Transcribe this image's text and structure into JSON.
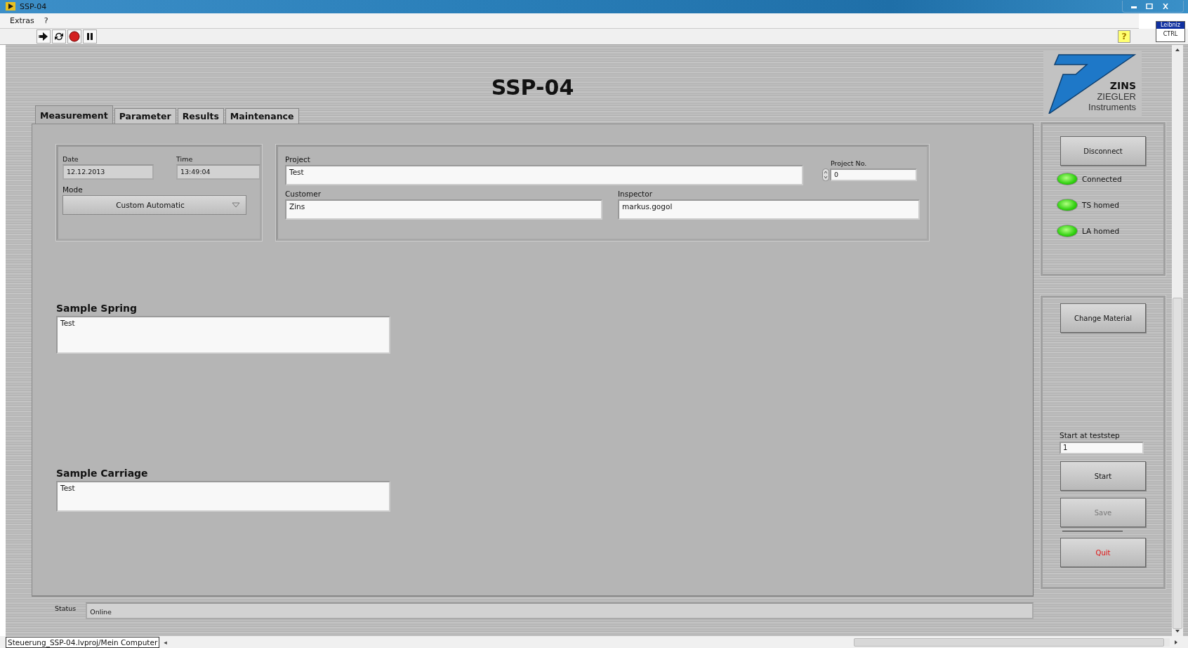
{
  "window": {
    "title": "SSP-04"
  },
  "menu": [
    "Extras",
    "?"
  ],
  "help_button": "?",
  "badge": {
    "top": "Leibniz",
    "label": "CTRL"
  },
  "heading": "SSP-04",
  "logo": {
    "brand": "ZINS",
    "line_1": "ZIEGLER",
    "line_2": "Instruments"
  },
  "tabs": [
    {
      "label": "Measurement",
      "selected": true
    },
    {
      "label": "Parameter",
      "selected": false
    },
    {
      "label": "Results",
      "selected": false
    },
    {
      "label": "Maintenance",
      "selected": false
    }
  ],
  "date": {
    "label": "Date",
    "value": "12.12.2013"
  },
  "time": {
    "label": "Time",
    "value": "13:49:04"
  },
  "mode": {
    "label": "Mode",
    "value": "Custom Automatic"
  },
  "project": {
    "label": "Project",
    "value": "Test"
  },
  "project_no": {
    "label": "Project No.",
    "value": "0"
  },
  "customer": {
    "label": "Customer",
    "value": "Zins"
  },
  "inspector": {
    "label": "Inspector",
    "value": "markus.gogol"
  },
  "sample_spring": {
    "label": "Sample Spring",
    "value": "Test"
  },
  "sample_carriage": {
    "label": "Sample Carriage",
    "value": "Test"
  },
  "disconnect_button": "Disconnect",
  "indicators": [
    {
      "label": "Connected",
      "on": true
    },
    {
      "label": "TS homed",
      "on": true
    },
    {
      "label": "LA homed",
      "on": true
    }
  ],
  "change_material_button": "Change Material",
  "start_step": {
    "label": "Start at teststep",
    "value": "1"
  },
  "start_button": {
    "label": "Start",
    "disabled": false
  },
  "save_button": {
    "label": "Save",
    "disabled": true
  },
  "quit_button": {
    "label": "Quit",
    "disabled": false
  },
  "status": {
    "label": "Status",
    "value": "Online"
  },
  "project_path": "Steuerung_SSP-04.lvproj/Mein Computer",
  "scroll_left": "◂"
}
